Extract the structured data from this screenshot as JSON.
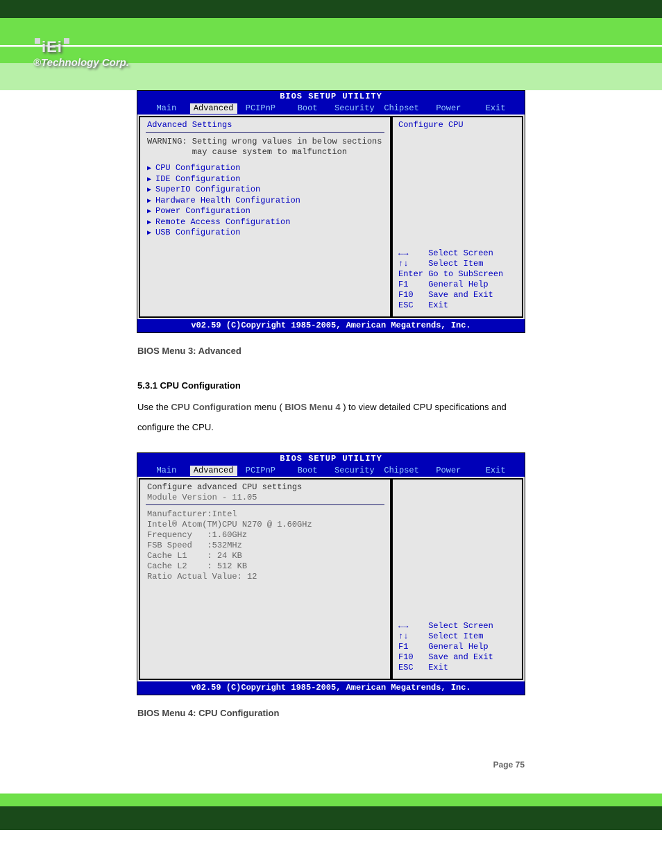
{
  "header": {
    "logo_text": "iEi",
    "tagline": "®Technology Corp."
  },
  "bios_common": {
    "title": "BIOS SETUP UTILITY",
    "menubar": [
      "Main",
      "Advanced",
      "PCIPnP",
      "Boot",
      "Security",
      "Chipset",
      "Power",
      "Exit"
    ],
    "footer": "v02.59 (C)Copyright 1985-2005, American Megatrends, Inc."
  },
  "bios1": {
    "panel_title": "Advanced Settings",
    "warning_l1": "WARNING: Setting wrong values in below sections",
    "warning_l2": "         may cause system to malfunction",
    "items": [
      "CPU Configuration",
      "IDE Configuration",
      "SuperIO Configuration",
      "Hardware Health Configuration",
      "Power Configuration",
      "Remote Access Configuration",
      "USB Configuration"
    ],
    "right_help_title": "Configure CPU",
    "keyhelp": [
      "←→    Select Screen",
      "↑↓    Select Item",
      "Enter Go to SubScreen",
      "F1    General Help",
      "F10   Save and Exit",
      "ESC   Exit"
    ]
  },
  "section_heading": "5.3.1 CPU Configuration",
  "paragraph": {
    "t1": "Use the ",
    "t2": "CPU Configuration",
    "t3": " menu (",
    "t4": "BIOS Menu 4",
    "t5": ") to view detailed CPU specifications and configure the CPU."
  },
  "bios2": {
    "panel_title": "Configure advanced CPU settings",
    "module_line": "Module Version - 11.05",
    "lines": [
      "Manufacturer:Intel",
      "Intel® Atom(TM)CPU N270 @ 1.60GHz",
      "Frequency   :1.60GHz",
      "FSB Speed   :532MHz",
      "",
      "Cache L1    : 24 KB",
      "Cache L2    : 512 KB",
      "",
      "Ratio Actual Value: 12"
    ],
    "keyhelp": [
      "←→    Select Screen",
      "↑↓    Select Item",
      "F1    General Help",
      "F10   Save and Exit",
      "ESC   Exit"
    ]
  },
  "caption1": "BIOS Menu 3: Advanced",
  "caption2": "BIOS Menu 4: CPU Configuration",
  "page_number": "Page 75"
}
